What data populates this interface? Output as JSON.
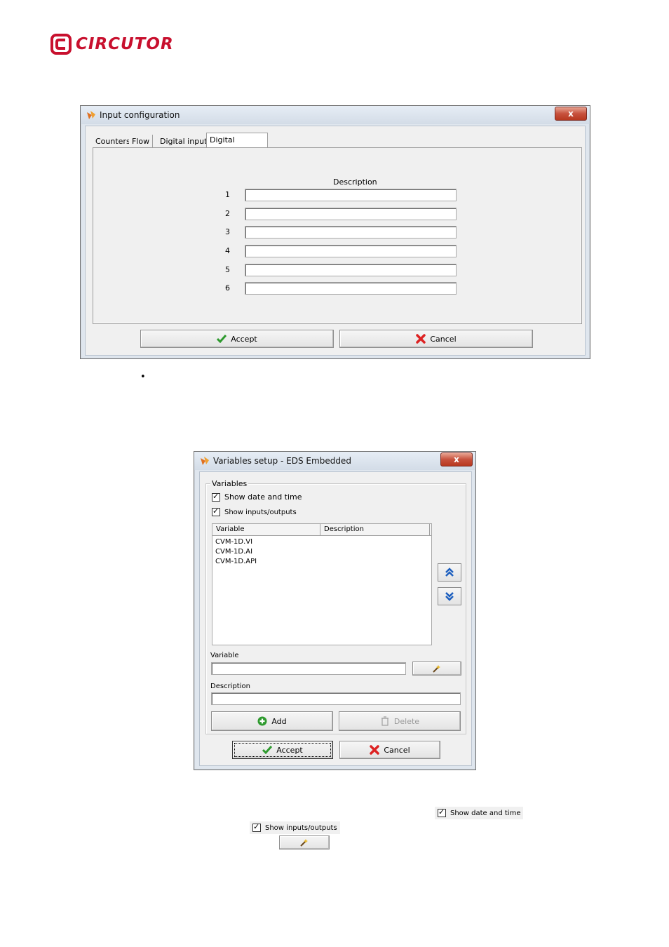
{
  "logo": {
    "text": "CIRCUTOR",
    "color": "#c8102e"
  },
  "input_config": {
    "title": "Input configuration",
    "close": "x",
    "tabs": [
      "Counters",
      "Flow",
      "Digital inputs",
      "Digital outputs"
    ],
    "active_tab": "Digital outputs",
    "description_header": "Description",
    "rows": [
      "1",
      "2",
      "3",
      "4",
      "5",
      "6"
    ],
    "accept_label": "Accept",
    "cancel_label": "Cancel"
  },
  "bullet": "•",
  "variables_setup": {
    "title": "Variables setup - EDS Embedded",
    "close": "x",
    "group_label": "Variables",
    "show_date_time": "Show date and time",
    "show_io": "Show inputs/outputs",
    "columns": [
      "Variable",
      "Description"
    ],
    "items": [
      "CVM-1D.VI",
      "CVM-1D.AI",
      "CVM-1D.API"
    ],
    "variable_label": "Variable",
    "description_label": "Description",
    "add_label": "Add",
    "delete_label": "Delete",
    "accept_label": "Accept",
    "cancel_label": "Cancel"
  },
  "inline": {
    "show_date_time": "Show date and time",
    "show_io": "Show inputs/outputs"
  }
}
